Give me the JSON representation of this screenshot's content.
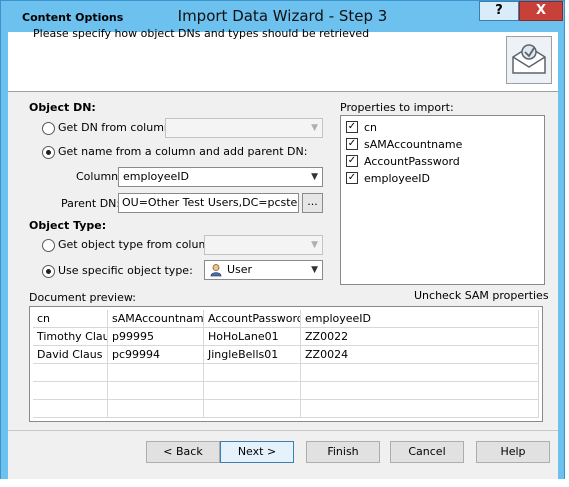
{
  "window": {
    "title": "Import Data Wizard - Step 3",
    "help_glyph": "?",
    "close_glyph": "X"
  },
  "header": {
    "title": "Content Options",
    "subtitle": "Please specify how object DNs and types should be retrieved"
  },
  "object_dn": {
    "heading": "Object DN:",
    "opt_column_label": "Get DN from column:",
    "opt_column_value": "",
    "opt_parent_label": "Get name from a column and add parent DN:",
    "column_label": "Column:",
    "column_value": "employeeID",
    "parent_label": "Parent DN:",
    "parent_value": "OU=Other Test Users,DC=pcstest,",
    "browse_label": "..."
  },
  "object_type": {
    "heading": "Object Type:",
    "opt_column_label": "Get object type from column:",
    "opt_column_value": "",
    "opt_specific_label": "Use specific object type:",
    "specific_value": "User"
  },
  "properties": {
    "label": "Properties to import:",
    "items": [
      {
        "name": "cn",
        "checked": true
      },
      {
        "name": "sAMAccountname",
        "checked": true
      },
      {
        "name": "AccountPassword",
        "checked": true
      },
      {
        "name": "employeeID",
        "checked": true
      }
    ],
    "uncheck_link": "Uncheck SAM properties"
  },
  "preview": {
    "label": "Document preview:",
    "columns": [
      "cn",
      "sAMAccountname",
      "AccountPassword",
      "employeeID"
    ],
    "rows": [
      [
        "Timothy Claus",
        "p99995",
        "HoHoLane01",
        "ZZ0022"
      ],
      [
        "David Claus",
        "pc99994",
        "JingleBells01",
        "ZZ0024"
      ]
    ]
  },
  "buttons": {
    "back": "< Back",
    "next": "Next >",
    "finish": "Finish",
    "cancel": "Cancel",
    "help": "Help"
  },
  "icons": {
    "check": "✓",
    "dropdown": "▼"
  }
}
